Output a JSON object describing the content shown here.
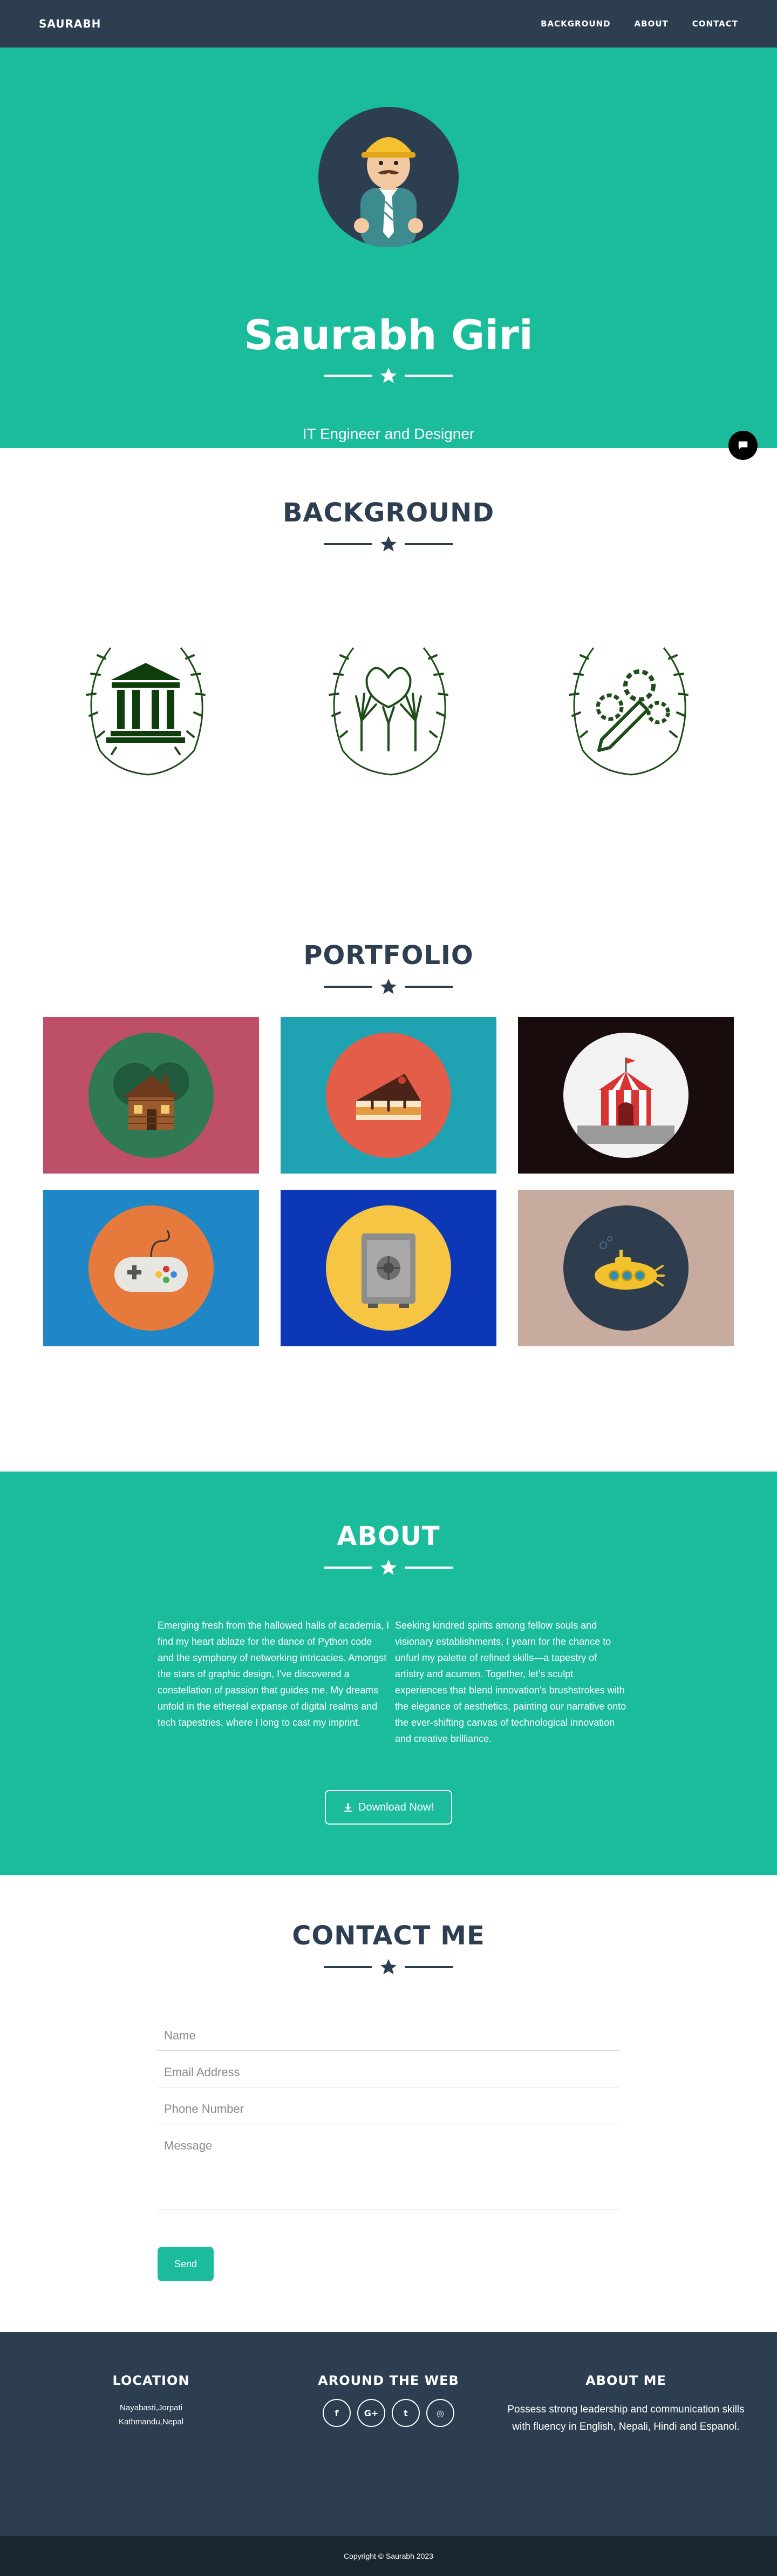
{
  "navbar": {
    "brand": "SAURABH",
    "links": [
      "BACKGROUND",
      "ABOUT",
      "CONTACT"
    ]
  },
  "hero": {
    "name": "Saurabh Giri",
    "subtitle": "IT Engineer and Designer"
  },
  "background": {
    "title": "BACKGROUND",
    "icons": [
      "bank-building-icon",
      "raised-hands-icon",
      "design-pencil-gears-icon"
    ]
  },
  "portfolio": {
    "title": "PORTFOLIO",
    "items": [
      {
        "icon": "cabin-icon",
        "bg": "#be4f68",
        "circle": "#2f7a55"
      },
      {
        "icon": "cake-slice-icon",
        "bg": "#1fa3b2",
        "circle": "#e35d49"
      },
      {
        "icon": "circus-tent-icon",
        "bg": "#180d0c",
        "circle": "#f2f2f2"
      },
      {
        "icon": "game-controller-icon",
        "bg": "#1f87c8",
        "circle": "#e67a3c"
      },
      {
        "icon": "safe-icon",
        "bg": "#0c38b8",
        "circle": "#f5c543"
      },
      {
        "icon": "submarine-icon",
        "bg": "#c7ab9f",
        "circle": "#2e3d4d"
      }
    ]
  },
  "about": {
    "title": "ABOUT",
    "left": "Emerging fresh from the hallowed halls of academia, I find my heart ablaze for the dance of Python code and the symphony of networking intricacies. Amongst the stars of graphic design, I've discovered a constellation of passion that guides me. My dreams unfold in the ethereal expanse of digital realms and tech tapestries, where I long to cast my imprint.",
    "right": "Seeking kindred spirits among fellow souls and visionary establishments, I yearn for the chance to unfurl my palette of refined skills—a tapestry of artistry and acumen. Together, let's sculpt experiences that blend innovation's brushstrokes with the elegance of aesthetics, painting our narrative onto the ever-shifting canvas of technological innovation and creative brilliance.",
    "download_label": "Download Now!"
  },
  "contact": {
    "title": "CONTACT ME",
    "placeholders": {
      "name": "Name",
      "email": "Email Address",
      "phone": "Phone Number",
      "message": "Message"
    },
    "send_label": "Send"
  },
  "footer": {
    "location": {
      "title": "LOCATION",
      "line1": "Nayabasti,Jorpati",
      "line2": "Kathmandu,Nepal"
    },
    "web": {
      "title": "AROUND THE WEB",
      "links": [
        "f",
        "G+",
        "t",
        "◎"
      ]
    },
    "about": {
      "title": "ABOUT ME",
      "text": "Possess strong leadership and communication skills with fluency in English, Nepali, Hindi and Espanol."
    },
    "copyright": "Copyright © Saurabh 2023"
  },
  "colors": {
    "primary": "#2c3e50",
    "accent": "#1abc9c",
    "icon_green": "#1e4d1a"
  }
}
